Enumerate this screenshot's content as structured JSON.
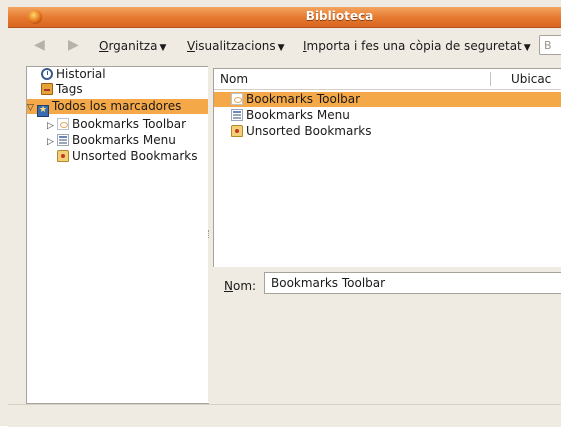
{
  "window": {
    "title": "Biblioteca"
  },
  "toolbar": {
    "back_icon": "back-arrow-icon",
    "forward_icon": "forward-arrow-icon",
    "menus": [
      {
        "label": "Organitza",
        "accel": "O",
        "rest": "rganitza"
      },
      {
        "label": "Visualitzacions",
        "accel": "V",
        "rest": "isualitzacions"
      },
      {
        "label": "Importa i fes una còpia de seguretat",
        "accel": "I",
        "rest": "mporta i fes una còpia de seguretat"
      }
    ],
    "search_partial": "B"
  },
  "sidebar": {
    "items": [
      {
        "label": "Historial",
        "icon": "history-clock-icon"
      },
      {
        "label": "Tags",
        "icon": "tags-icon"
      },
      {
        "label": "Todos los marcadores",
        "icon": "all-bookmarks-icon",
        "expanded": true,
        "selected": true
      },
      {
        "label": "Bookmarks Toolbar",
        "icon": "bookmarks-toolbar-icon",
        "collapsed": true
      },
      {
        "label": "Bookmarks Menu",
        "icon": "bookmarks-menu-icon",
        "collapsed": true
      },
      {
        "label": "Unsorted Bookmarks",
        "icon": "unsorted-bookmarks-icon"
      }
    ]
  },
  "list": {
    "columns": [
      "Nom",
      "Ubicac"
    ],
    "rows": [
      {
        "name": "Bookmarks Toolbar",
        "icon": "bookmarks-toolbar-icon",
        "selected": true
      },
      {
        "name": "Bookmarks Menu",
        "icon": "bookmarks-menu-icon"
      },
      {
        "name": "Unsorted Bookmarks",
        "icon": "unsorted-bookmarks-icon"
      }
    ]
  },
  "details": {
    "name_label_accel": "N",
    "name_label_rest": "om:",
    "name_value": "Bookmarks Toolbar"
  },
  "colors": {
    "selection": "#f5a847",
    "titlebar": "#e5782f",
    "window_bg": "#efebe3"
  }
}
